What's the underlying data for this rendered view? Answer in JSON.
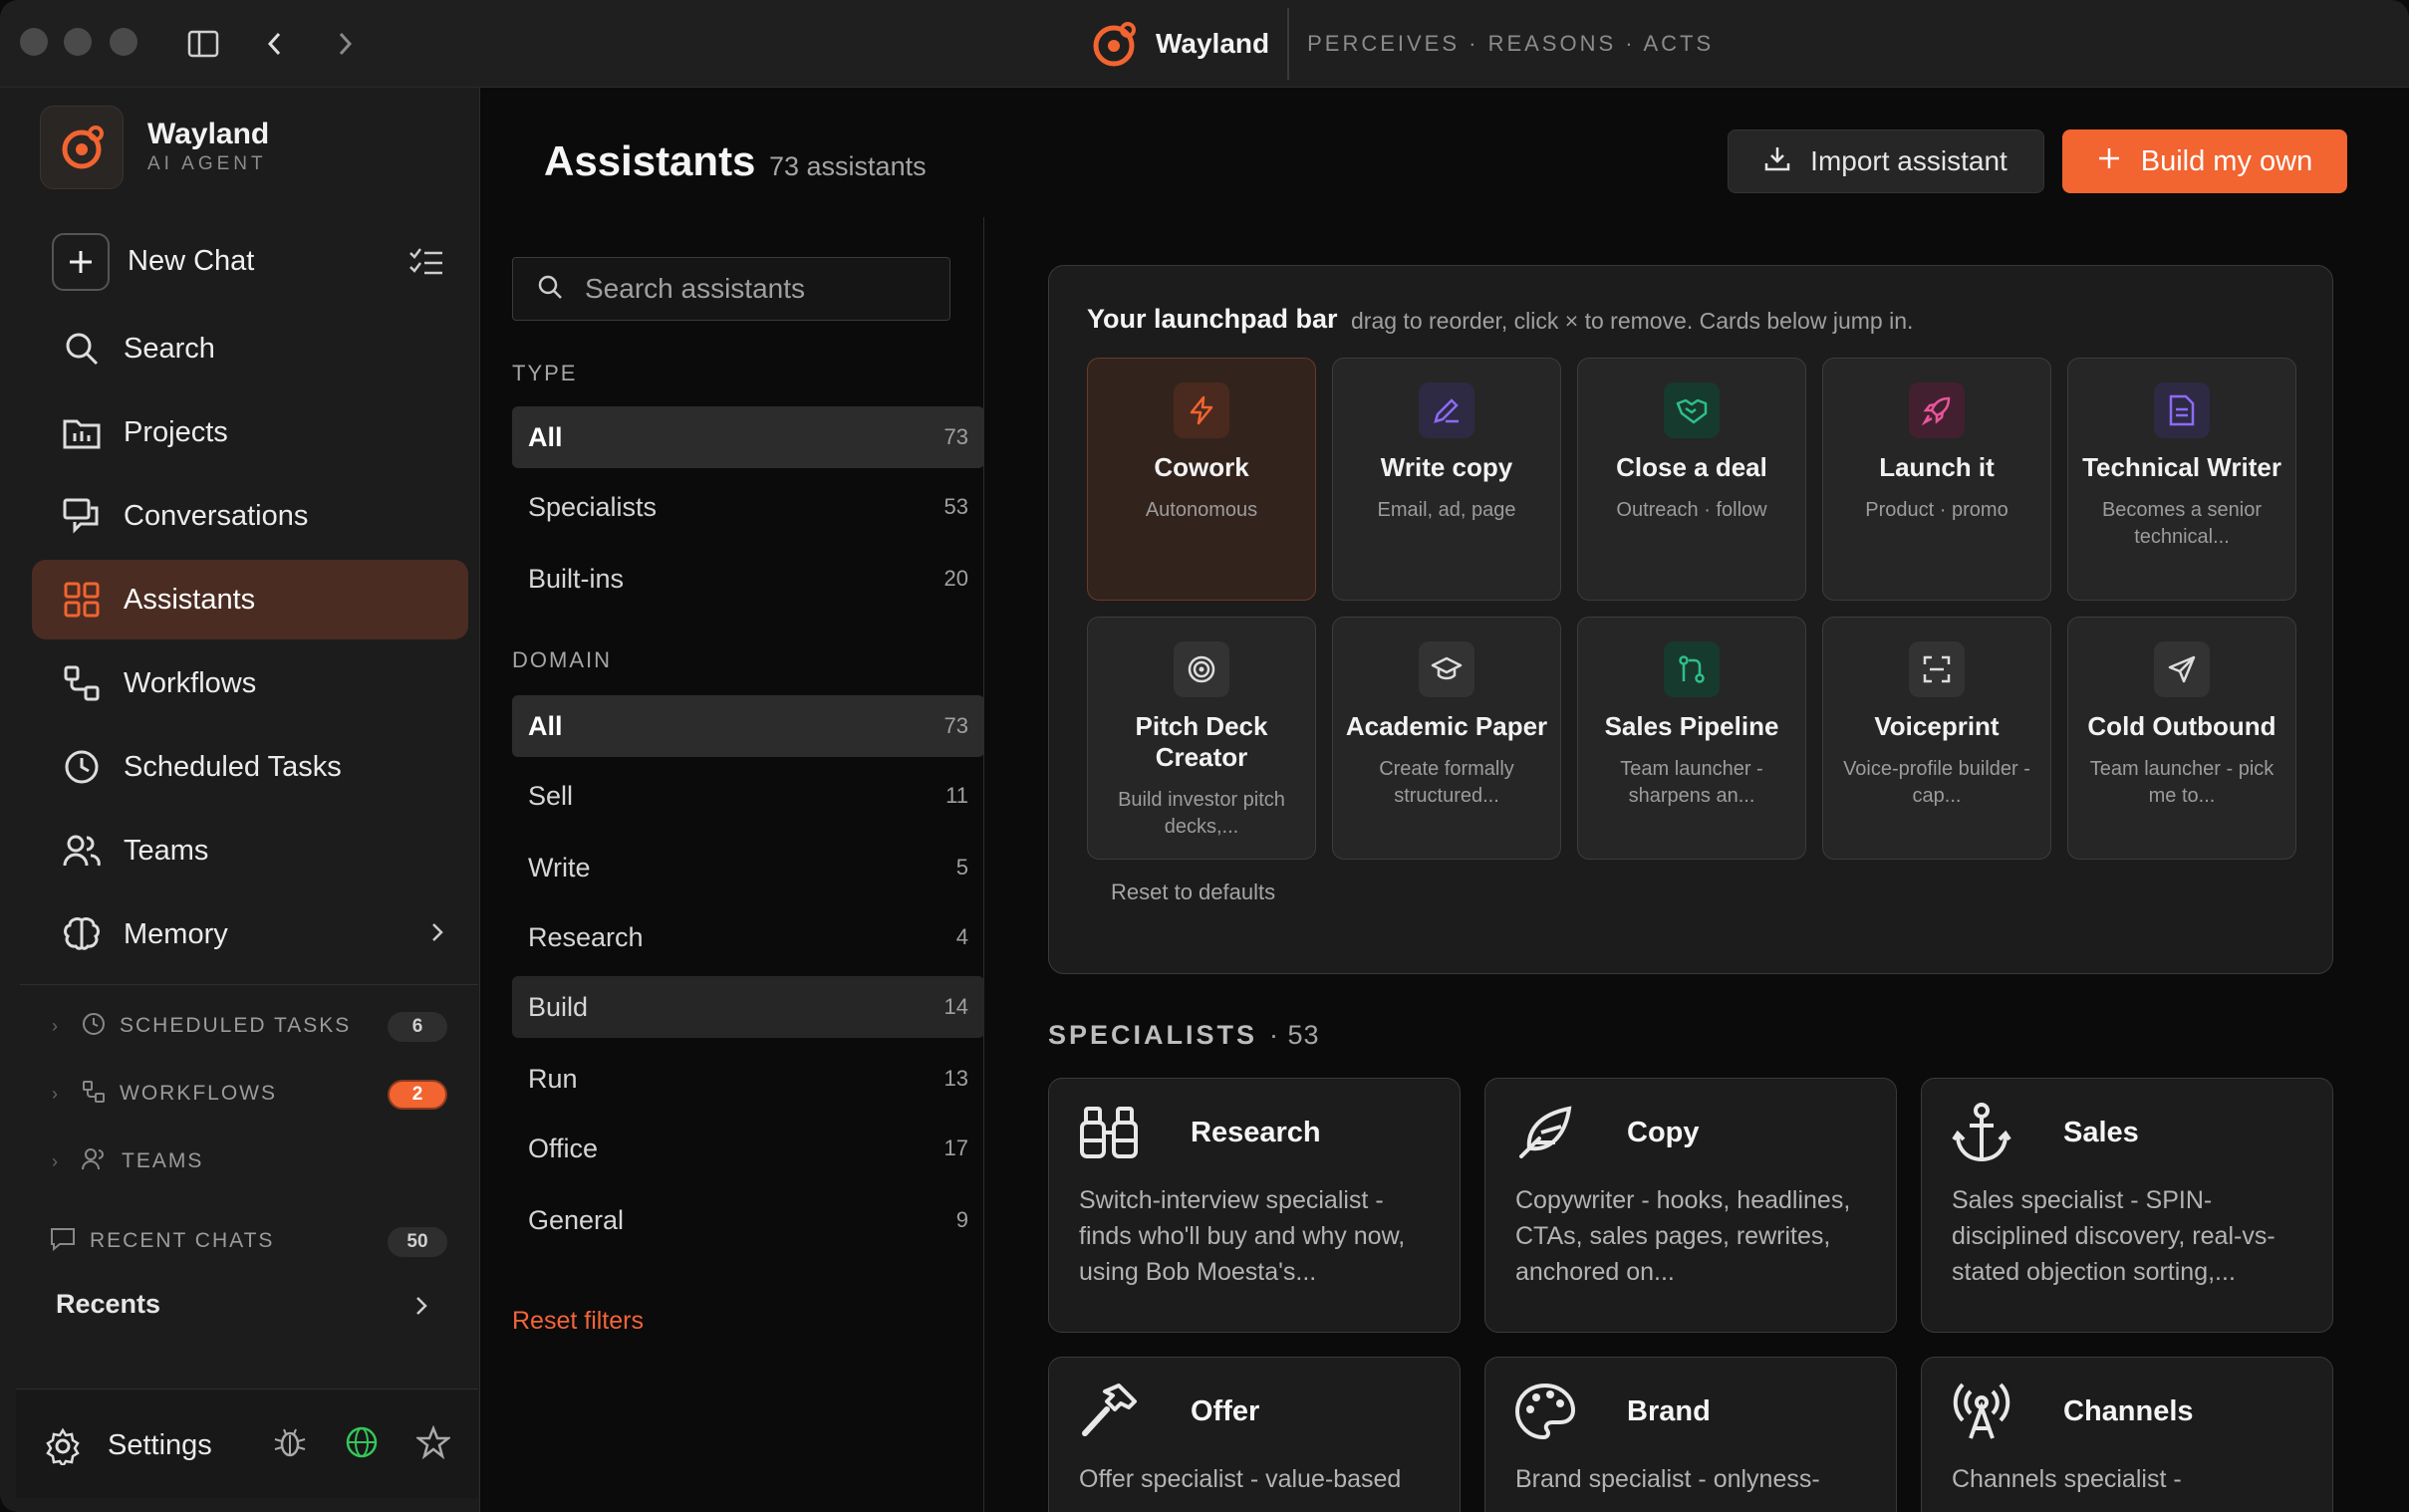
{
  "titlebar": {
    "app_name": "Wayland",
    "tagline": "PERCEIVES · REASONS · ACTS"
  },
  "sidebar": {
    "app_name": "Wayland",
    "app_sub": "AI AGENT",
    "new_chat": "New Chat",
    "nav": [
      {
        "label": "Search",
        "icon": "search-icon"
      },
      {
        "label": "Projects",
        "icon": "folder-icon"
      },
      {
        "label": "Conversations",
        "icon": "chat-bubbles-icon"
      },
      {
        "label": "Assistants",
        "icon": "grid-icon",
        "active": true
      },
      {
        "label": "Workflows",
        "icon": "workflow-icon"
      },
      {
        "label": "Scheduled Tasks",
        "icon": "clock-icon"
      },
      {
        "label": "Teams",
        "icon": "people-icon"
      },
      {
        "label": "Memory",
        "icon": "brain-icon"
      }
    ],
    "sections": [
      {
        "label": "SCHEDULED TASKS",
        "count": "6"
      },
      {
        "label": "WORKFLOWS",
        "count": "2"
      },
      {
        "label": "TEAMS"
      }
    ],
    "recent_chats": {
      "label": "RECENT CHATS",
      "count": "50"
    },
    "recents": "Recents",
    "settings": "Settings"
  },
  "header": {
    "title": "Assistants",
    "count": "73 assistants",
    "import": "Import assistant",
    "build": "Build my own"
  },
  "filters": {
    "search_placeholder": "Search assistants",
    "type_label": "TYPE",
    "type": [
      {
        "label": "All",
        "count": "73"
      },
      {
        "label": "Specialists",
        "count": "53"
      },
      {
        "label": "Built-ins",
        "count": "20"
      }
    ],
    "domain_label": "DOMAIN",
    "domain": [
      {
        "label": "All",
        "count": "73"
      },
      {
        "label": "Sell",
        "count": "11"
      },
      {
        "label": "Write",
        "count": "5"
      },
      {
        "label": "Research",
        "count": "4"
      },
      {
        "label": "Build",
        "count": "14"
      },
      {
        "label": "Run",
        "count": "13"
      },
      {
        "label": "Office",
        "count": "17"
      },
      {
        "label": "General",
        "count": "9"
      }
    ],
    "reset": "Reset filters"
  },
  "launchpad": {
    "title": "Your launchpad bar",
    "hint": "drag to reorder, click × to remove. Cards below jump in.",
    "cards": [
      {
        "title": "Cowork",
        "desc": "Autonomous",
        "icon": "bolt-icon",
        "color": "#f26430"
      },
      {
        "title": "Write copy",
        "desc": "Email, ad, page",
        "icon": "pencil-icon",
        "color": "#8b6cf5"
      },
      {
        "title": "Close a deal",
        "desc": "Outreach · follow",
        "icon": "handshake-icon",
        "color": "#2fbf8a"
      },
      {
        "title": "Launch it",
        "desc": "Product · promo",
        "icon": "rocket-icon",
        "color": "#e8559a"
      },
      {
        "title": "Technical Writer",
        "desc": "Becomes a senior technical...",
        "icon": "document-icon",
        "color": "#8b6cf5"
      },
      {
        "title": "Pitch Deck Creator",
        "desc": "Build investor pitch decks,...",
        "icon": "target-icon",
        "color": "#d8d8d8"
      },
      {
        "title": "Academic Paper",
        "desc": "Create formally structured...",
        "icon": "graduation-cap-icon",
        "color": "#d8d8d8"
      },
      {
        "title": "Sales Pipeline",
        "desc": "Team launcher - sharpens an...",
        "icon": "pipeline-icon",
        "color": "#2fbf8a"
      },
      {
        "title": "Voiceprint",
        "desc": "Voice-profile builder - cap...",
        "icon": "scan-icon",
        "color": "#d8d8d8"
      },
      {
        "title": "Cold Outbound",
        "desc": "Team launcher - pick me to...",
        "icon": "send-icon",
        "color": "#d8d8d8"
      }
    ],
    "reset": "Reset to defaults"
  },
  "specialists": {
    "label": "SPECIALISTS",
    "count": "· 53",
    "cards": [
      {
        "title": "Research",
        "desc": "Switch-interview specialist - finds who'll buy and why now, using Bob Moesta's...",
        "icon": "binoculars-icon"
      },
      {
        "title": "Copy",
        "desc": "Copywriter - hooks, headlines, CTAs, sales pages, rewrites, anchored on...",
        "icon": "feather-icon"
      },
      {
        "title": "Sales",
        "desc": "Sales specialist - SPIN-disciplined discovery, real-vs-stated objection sorting,...",
        "icon": "anchor-icon"
      },
      {
        "title": "Offer",
        "desc": "Offer specialist - value-based",
        "icon": "hammer-icon"
      },
      {
        "title": "Brand",
        "desc": "Brand specialist - onlyness-",
        "icon": "palette-icon"
      },
      {
        "title": "Channels",
        "desc": "Channels specialist -",
        "icon": "antenna-icon"
      }
    ]
  },
  "colors": {
    "accent": "#f26430",
    "active_bg": "#4a2c22"
  }
}
